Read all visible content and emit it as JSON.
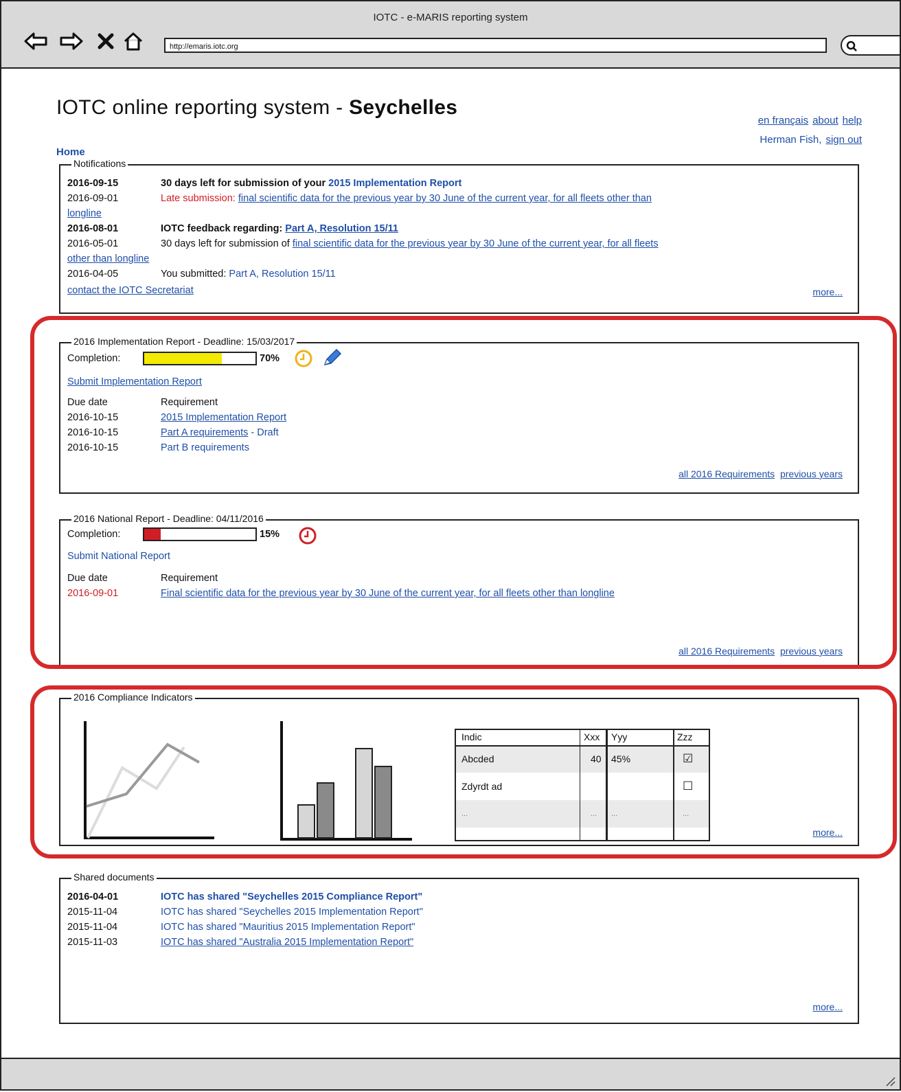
{
  "window": {
    "title": "IOTC - e-MARIS reporting system",
    "url": "http://emaris.iotc.org"
  },
  "header": {
    "title_prefix": "IOTC online reporting system - ",
    "title_country": "Seychelles",
    "links": [
      "en français",
      "about",
      "help"
    ],
    "user_name": "Herman Fish,",
    "sign_out": "sign out",
    "breadcrumb_home": "Home"
  },
  "notifications": {
    "legend": "Notifications",
    "items": [
      {
        "date": "2016-09-15",
        "text": "30 days left for submission of your ",
        "link": "2015 Implementation Report"
      },
      {
        "date": "2016-09-01",
        "text": "Late submission: ",
        "link": "final scientific data for the previous year by 30 June of the current year, for all fleets other than",
        "link2": "longline"
      },
      {
        "date": "2016-08-01",
        "text": "IOTC feedback regarding: ",
        "link": "Part A, Resolution 15/11"
      },
      {
        "date": "2016-05-01",
        "text": "30 days left for submission of ",
        "link": "final scientific data for the previous year by 30 June of the current year, for all fleets",
        "link2": "other than longline"
      },
      {
        "date": "2016-04-05",
        "text": "You submitted: ",
        "link": "Part A, Resolution 15/11"
      }
    ],
    "contact": "contact the IOTC Secretariat",
    "more": "more..."
  },
  "implementation": {
    "legend": "2016 Implementation Report - Deadline: 15/03/2017",
    "completion_label": "Completion:",
    "completion": 70,
    "completion_text": "70%",
    "bar_color": "#f2ea00",
    "submit": "Submit Implementation Report",
    "col_due": "Due date",
    "col_req": "Requirement",
    "rows": [
      {
        "date": "2016-10-15",
        "req": "2015 Implementation Report",
        "suffix": ""
      },
      {
        "date": "2016-10-15",
        "req": "Part A requirements",
        "suffix": " - Draft"
      },
      {
        "date": "2016-10-15",
        "req": "Part B requirements",
        "suffix": ""
      }
    ],
    "all_reqs": "all 2016 Requirements",
    "previous": "previous years"
  },
  "national": {
    "legend": "2016 National Report - Deadline: 04/11/2016",
    "completion_label": "Completion:",
    "completion": 15,
    "completion_text": "15%",
    "bar_color": "#d01e26",
    "submit": "Submit National Report",
    "col_due": "Due date",
    "col_req": "Requirement",
    "rows": [
      {
        "date": "2016-09-01",
        "req": "Final scientific data for the previous year by 30 June of the current year, for all fleets other than longline"
      }
    ],
    "all_reqs": "all 2016 Requirements",
    "previous": "previous years"
  },
  "compliance": {
    "legend": "2016 Compliance Indicators",
    "table": {
      "headers": [
        "Indic",
        "Xxx",
        "Yyy",
        "Zzz"
      ],
      "rows": [
        [
          "Abcded",
          "40",
          "45%",
          "☑"
        ],
        [
          "Zdyrdt ad",
          "",
          "",
          "☐"
        ],
        [
          "...",
          "...",
          "...",
          "..."
        ]
      ]
    },
    "more": "more..."
  },
  "shared": {
    "legend": "Shared documents",
    "items": [
      {
        "date": "2016-04-01",
        "text": "IOTC has shared \"Seychelles 2015 Compliance Report\""
      },
      {
        "date": "2015-11-04",
        "text": "IOTC has shared \"Seychelles 2015 Implementation Report\""
      },
      {
        "date": "2015-11-04",
        "text": "IOTC has shared \"Mauritius 2015 Implementation Report\""
      },
      {
        "date": "2015-11-03",
        "text": "IOTC has shared \"Australia 2015 Implementation Report\""
      }
    ],
    "more": "more..."
  },
  "colors": {
    "link": "#1f4fa8",
    "alert": "#d01e26",
    "highlight": "#d62a2a",
    "chrome": "#d9d9d9"
  }
}
